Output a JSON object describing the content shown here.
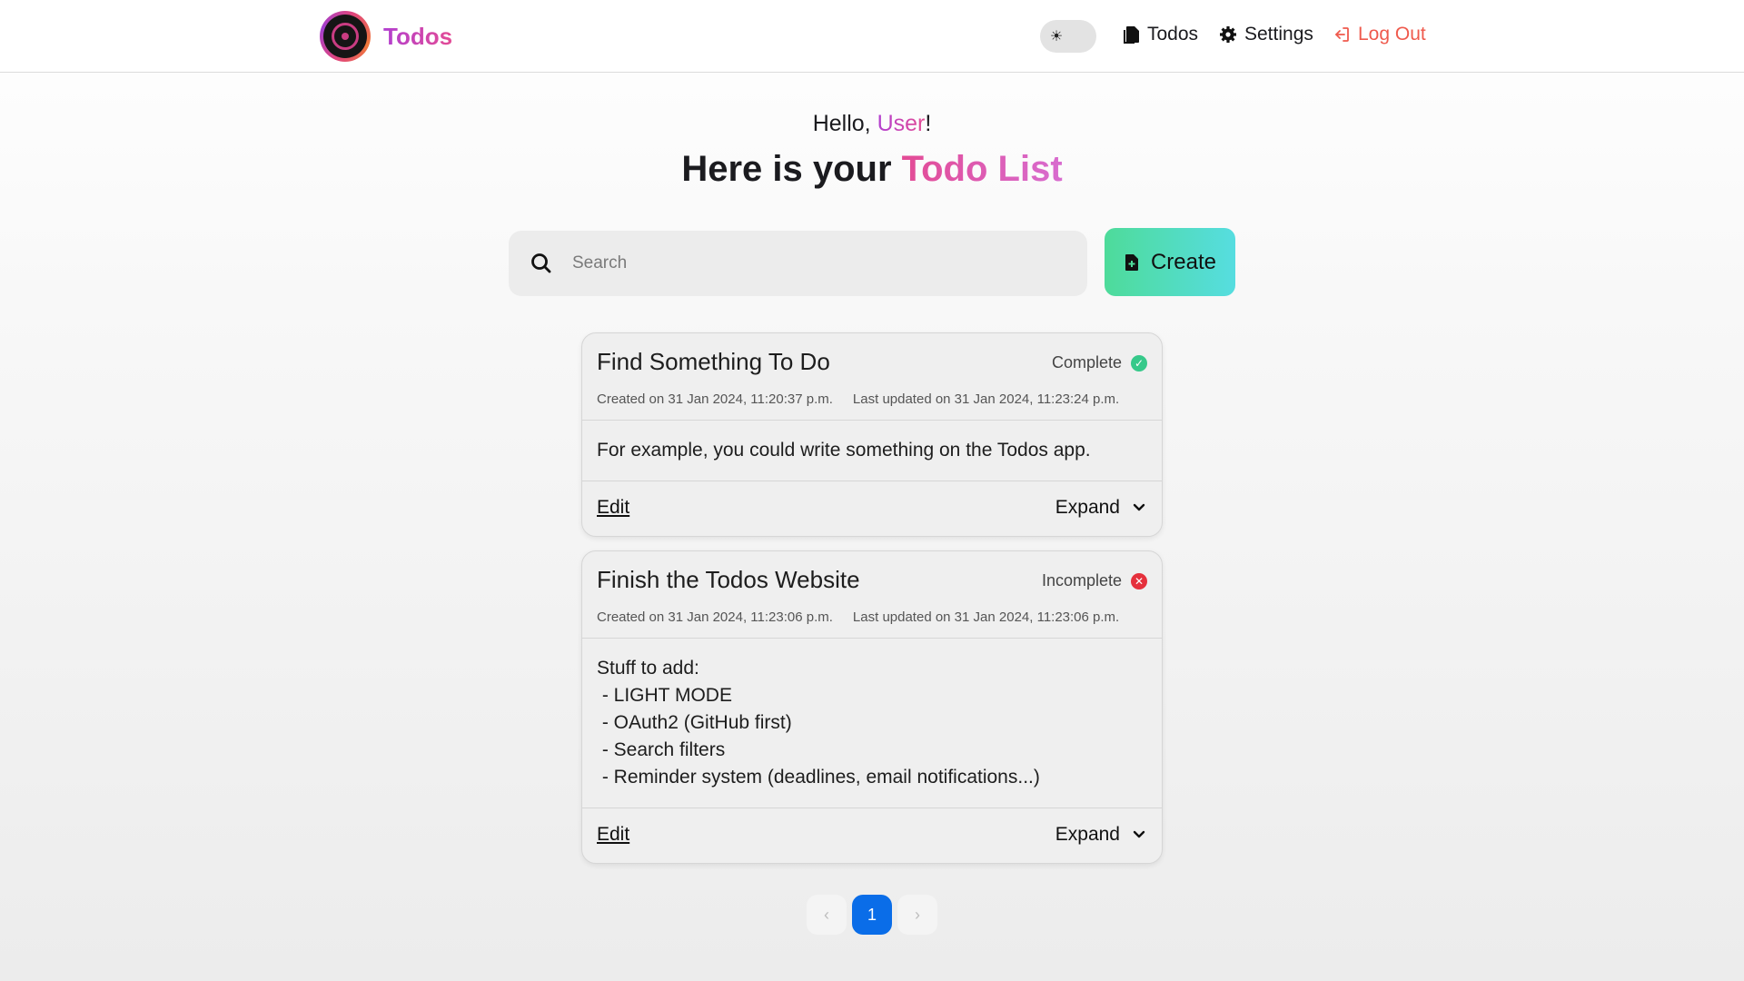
{
  "header": {
    "brand": "Todos",
    "nav": {
      "todos": "Todos",
      "settings": "Settings",
      "logout": "Log Out"
    }
  },
  "greeting": {
    "prefix": "Hello, ",
    "user": "User",
    "suffix": "!"
  },
  "headline": {
    "prefix": "Here is your ",
    "highlight": "Todo List"
  },
  "search": {
    "placeholder": "Search",
    "value": ""
  },
  "create_label": "Create",
  "todos": [
    {
      "title": "Find Something To Do",
      "status": "Complete",
      "created": "Created on 31 Jan 2024, 11:20:37 p.m.",
      "updated": "Last updated on 31 Jan 2024, 11:23:24 p.m.",
      "body": [
        "For example, you could write something on the Todos app."
      ],
      "edit_label": "Edit",
      "expand_label": "Expand"
    },
    {
      "title": "Finish the Todos Website",
      "status": "Incomplete",
      "created": "Created on 31 Jan 2024, 11:23:06 p.m.",
      "updated": "Last updated on 31 Jan 2024, 11:23:06 p.m.",
      "body": [
        "Stuff to add:",
        " - LIGHT MODE",
        " - OAuth2 (GitHub first)",
        " - Search filters",
        " - Reminder system (deadlines, email notifications...)"
      ],
      "edit_label": "Edit",
      "expand_label": "Expand"
    }
  ],
  "pagination": {
    "current": "1",
    "prev": "‹",
    "next": "›"
  },
  "colors": {
    "accent_pink": "#e34b95",
    "accent_purple": "#b23fd0",
    "create_from": "#4edb9a",
    "create_to": "#56dde0",
    "logout": "#ef5a4d",
    "complete": "#36c98a",
    "incomplete": "#e5303c",
    "page_active": "#0a6de8"
  }
}
